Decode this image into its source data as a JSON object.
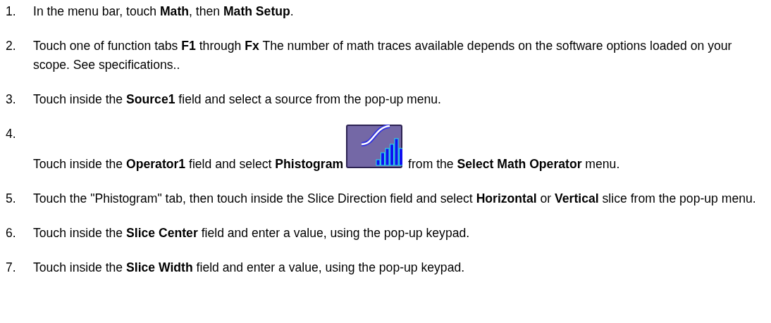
{
  "steps": [
    {
      "kind": "text",
      "number": "1.",
      "text": "In the menu bar, touch **Math**, then **Math Setup**."
    },
    {
      "kind": "text",
      "number": "2.",
      "text": "Touch one of function tabs **F1** through **Fx** The number of math traces available depends on the software options loaded on your scope. See specifications.."
    },
    {
      "kind": "text",
      "number": "3.",
      "text": "Touch inside the **Source1** field and select a source from the pop-up menu."
    },
    {
      "kind": "icon_step",
      "number": "4.",
      "text": "Touch inside the **Operator1** field and select **Phistogram**",
      "text_after": "from the **Select Math Operator** menu."
    },
    {
      "kind": "text",
      "number": "5.",
      "text": "Touch the \"Phistogram\" tab, then touch inside the Slice Direction field and select **Horizontal** or **Vertical** slice from the pop-up menu."
    },
    {
      "kind": "text",
      "number": "6.",
      "text": "Touch inside the **Slice Center** field and enter a value, using the pop-up keypad."
    },
    {
      "kind": "text",
      "number": "7.",
      "text": "Touch inside the **Slice Width** field and enter a value, using the pop-up keypad."
    }
  ]
}
